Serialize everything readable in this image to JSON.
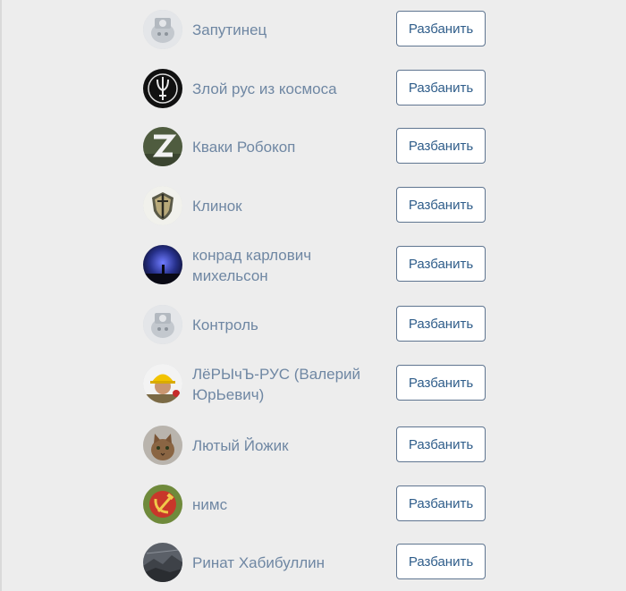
{
  "unban_label": "Разбанить",
  "users": [
    {
      "name": "Запутинец",
      "avatar": "camera-placeholder-icon"
    },
    {
      "name": "Злой рус из космоса",
      "avatar": "trident-emblem-icon"
    },
    {
      "name": "Кваки Робокоп",
      "avatar": "z-letter-icon"
    },
    {
      "name": "Клинок",
      "avatar": "shield-sword-icon"
    },
    {
      "name": "конрад карлович михельсон",
      "avatar": "night-sky-photo-icon"
    },
    {
      "name": "Контроль",
      "avatar": "camera-placeholder-icon"
    },
    {
      "name": "ЛёРЫчЪ-РУС (Валерий ЮрЬевич)",
      "avatar": "hard-hat-person-icon"
    },
    {
      "name": "Лютый Йожик",
      "avatar": "cat-photo-icon"
    },
    {
      "name": "нимс",
      "avatar": "hammer-sickle-icon"
    },
    {
      "name": "Ринат Хабибуллин",
      "avatar": "landscape-photo-icon"
    }
  ],
  "colors": {
    "background": "#ededed",
    "name_text": "#6f87a3",
    "button_text": "#2f5d8a",
    "button_border": "#5f7590"
  }
}
